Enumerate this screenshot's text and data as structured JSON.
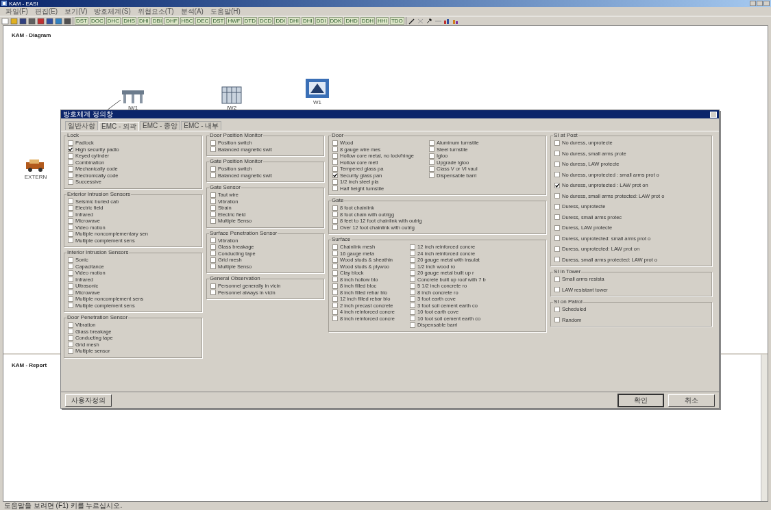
{
  "window": {
    "title": "KAM - EASI"
  },
  "menu": [
    "파일(F)",
    "편집(E)",
    "보기(V)",
    "방호체계(S)",
    "위협요소(T)",
    "분석(A)",
    "도움말(H)"
  ],
  "toolbar": {
    "codes": [
      "DST",
      "DOC",
      "DHC",
      "DHS",
      "DHI",
      "DBI",
      "DHF",
      "HBC",
      "DEC",
      "DST",
      "HWF",
      "DTD",
      "DCD",
      "DDI",
      "DHI",
      "DHI",
      "DDI",
      "DDK",
      "DHD",
      "DDH",
      "HHI",
      "TDO"
    ]
  },
  "diagram": {
    "title": "KAM - Diagram",
    "nodes": [
      {
        "label": "IW1",
        "kind": "fence"
      },
      {
        "label": "IW2",
        "kind": "gate"
      },
      {
        "label": "W1",
        "kind": "building"
      },
      {
        "label": "EXTERN",
        "kind": "vehicle"
      }
    ]
  },
  "report": {
    "title": "KAM - Report"
  },
  "dialog": {
    "title": "방호체계 정의창",
    "tabs": [
      {
        "label": "일반사항",
        "selected": false
      },
      {
        "label": "EMC - 외곽",
        "selected": true
      },
      {
        "label": "EMC - 중앙",
        "selected": false
      },
      {
        "label": "EMC - 내부",
        "selected": false
      }
    ],
    "columns": [
      [
        {
          "title": "Lock",
          "columns": [
            [
              {
                "label": "Padlock",
                "checked": false
              },
              {
                "label": "High security padlo",
                "checked": true
              },
              {
                "label": "Keyed cylinder",
                "checked": false
              },
              {
                "label": "Combination",
                "checked": false
              },
              {
                "label": "Mechanically code",
                "checked": false
              },
              {
                "label": "Electronically code",
                "checked": false
              },
              {
                "label": "Successive",
                "checked": false
              }
            ]
          ]
        },
        {
          "title": "Exterior Intrusion Sensors",
          "columns": [
            [
              {
                "label": "Seismic buried cab",
                "checked": false
              },
              {
                "label": "Electric field",
                "checked": false
              },
              {
                "label": "Infrared",
                "checked": false
              },
              {
                "label": "Microwave",
                "checked": false
              },
              {
                "label": "Video motion",
                "checked": false
              },
              {
                "label": "Multiple noncomplementary sen",
                "checked": false
              },
              {
                "label": "Multiple complement sens",
                "checked": false
              }
            ]
          ]
        },
        {
          "title": "Interior Intrusion Sensors",
          "columns": [
            [
              {
                "label": "Sonic",
                "checked": false
              },
              {
                "label": "Capacitance",
                "checked": false
              },
              {
                "label": "Video motion",
                "checked": false
              },
              {
                "label": "Infrared",
                "checked": false
              },
              {
                "label": "Ultrasonic",
                "checked": false
              },
              {
                "label": "Microwave",
                "checked": false
              },
              {
                "label": "Multiple noncomplement sens",
                "checked": false
              },
              {
                "label": "Multiple complement sens",
                "checked": false
              }
            ]
          ]
        },
        {
          "title": "Door Penetration Sensor",
          "columns": [
            [
              {
                "label": "Vibration",
                "checked": false
              },
              {
                "label": "Glass breakage",
                "checked": false
              },
              {
                "label": "Conducting tape",
                "checked": false
              },
              {
                "label": "Grid mesh",
                "checked": false
              },
              {
                "label": "Multiple sensor",
                "checked": false
              }
            ]
          ]
        }
      ],
      [
        {
          "title": "Door Position Monitor",
          "columns": [
            [
              {
                "label": "Position switch",
                "checked": false
              },
              {
                "label": "Balanced magnetic swit",
                "checked": false
              }
            ]
          ]
        },
        {
          "title": "Gate Position Monitor",
          "columns": [
            [
              {
                "label": "Position switch",
                "checked": false
              },
              {
                "label": "Balanced magnetic swit",
                "checked": false
              }
            ]
          ]
        },
        {
          "title": "Gate Sensor",
          "columns": [
            [
              {
                "label": "Taut wire",
                "checked": false
              },
              {
                "label": "Vibration",
                "checked": false
              },
              {
                "label": "Strain",
                "checked": false
              },
              {
                "label": "Electric field",
                "checked": false
              },
              {
                "label": "Multiple Senso",
                "checked": false
              }
            ]
          ]
        },
        {
          "title": "Surface Penetration Sensor",
          "columns": [
            [
              {
                "label": "Vibration",
                "checked": false
              },
              {
                "label": "Glass breakage",
                "checked": false
              },
              {
                "label": "Conducting tape",
                "checked": false
              },
              {
                "label": "Grid mesh",
                "checked": false
              },
              {
                "label": "Multiple Senso",
                "checked": false
              }
            ]
          ]
        },
        {
          "title": "General Observation",
          "columns": [
            [
              {
                "label": "Personnel generally in vicin",
                "checked": false
              },
              {
                "label": "Personnel always in vicin",
                "checked": false
              }
            ]
          ]
        }
      ],
      [
        {
          "title": "Door",
          "columns": [
            [
              {
                "label": "Wood",
                "checked": false
              },
              {
                "label": "8 gauge wire mes",
                "checked": false
              },
              {
                "label": "Hollow core metal, no lock/hinge",
                "checked": false
              },
              {
                "label": "Hollow core metl",
                "checked": false
              },
              {
                "label": "Tempered glass pa",
                "checked": false
              },
              {
                "label": "Security glass pan",
                "checked": true
              },
              {
                "label": "1/2 inch steel pla",
                "checked": false
              },
              {
                "label": "Half height turnstile",
                "checked": false
              }
            ],
            [
              {
                "label": "Aluminum turnstile",
                "checked": false
              },
              {
                "label": "Steel turnstile",
                "checked": false
              },
              {
                "label": "Igloo",
                "checked": false
              },
              {
                "label": "Upgrade Igloo",
                "checked": false
              },
              {
                "label": "Class V or VI vaul",
                "checked": false
              },
              {
                "label": "Dispensable barri",
                "checked": false
              }
            ]
          ]
        },
        {
          "title": "Gate",
          "columns": [
            [
              {
                "label": "8 foot chainlink",
                "checked": false
              },
              {
                "label": "8 foot chain with outrigg",
                "checked": false
              },
              {
                "label": "8 feet to 12 foot chainlink with outrig",
                "checked": false
              },
              {
                "label": "Over 12 foot chainlink with outrig",
                "checked": false
              }
            ]
          ]
        },
        {
          "title": "Surface",
          "columns": [
            [
              {
                "label": "Chainlink mesh",
                "checked": false
              },
              {
                "label": "16 gauge meta",
                "checked": false
              },
              {
                "label": "Wood studs & sheathin",
                "checked": false
              },
              {
                "label": "Wood studs & plywoo",
                "checked": false
              },
              {
                "label": "Clay block",
                "checked": false
              },
              {
                "label": "8 inch hollow blo",
                "checked": false
              },
              {
                "label": "8 inch filled bloc",
                "checked": false
              },
              {
                "label": "8 inch filled rebar blo",
                "checked": false
              },
              {
                "label": "12 inch filled rebar blo",
                "checked": false
              },
              {
                "label": "2 inch precast concrete",
                "checked": false
              },
              {
                "label": "4 inch reinforced concre",
                "checked": false
              },
              {
                "label": "8 inch reinforced concre",
                "checked": false
              }
            ],
            [
              {
                "label": "12 inch reinforced concre",
                "checked": false
              },
              {
                "label": "24 inch reinforced concre",
                "checked": false
              },
              {
                "label": "20 gauge metal with insulat",
                "checked": false
              },
              {
                "label": "1/2 inch wood ro",
                "checked": false
              },
              {
                "label": "20 gauge metal built up r",
                "checked": false
              },
              {
                "label": "Concrete built up roof with 7 b",
                "checked": false
              },
              {
                "label": "5 1/2 inch concrete ro",
                "checked": false
              },
              {
                "label": "8 inch concrete ro",
                "checked": false
              },
              {
                "label": "3 foot earth cove",
                "checked": false
              },
              {
                "label": "3 foot soil cement earth co",
                "checked": false
              },
              {
                "label": "10 foot earth cove",
                "checked": false
              },
              {
                "label": "10 foot soil cement earth co",
                "checked": false
              },
              {
                "label": "Dispensable barri",
                "checked": false
              }
            ]
          ]
        }
      ],
      [
        {
          "title": "SI at Post",
          "columns": [
            [
              {
                "label": "No duress, unprotecte",
                "checked": false
              },
              {
                "label": "No duress, small arms prote",
                "checked": false
              },
              {
                "label": "No duress, LAW protecte",
                "checked": false
              },
              {
                "label": "No duress, unprotected : small arms prot o",
                "checked": false
              },
              {
                "label": "No duress, unprotected : LAW prot on",
                "checked": true
              },
              {
                "label": "No duress, small arms protected: LAW prot o",
                "checked": false
              },
              {
                "label": "Duress, unprotecte",
                "checked": false
              },
              {
                "label": "Duress, small arms protec",
                "checked": false
              },
              {
                "label": "Duress, LAW protecte",
                "checked": false
              },
              {
                "label": "Duress, unprotected: small arms prot o",
                "checked": false
              },
              {
                "label": "Duress, unprotected: LAW prot on",
                "checked": false
              },
              {
                "label": "Duress, small arms protected: LAW prot o",
                "checked": false
              }
            ]
          ]
        },
        {
          "title": "SI in Tower",
          "columns": [
            [
              {
                "label": "Small arms resista",
                "checked": false
              },
              {
                "label": "LAW resistant tower",
                "checked": false
              }
            ]
          ]
        },
        {
          "title": "SI on Patrol",
          "columns": [
            [
              {
                "label": "Scheduled",
                "checked": false
              },
              {
                "label": "Random",
                "checked": false
              }
            ]
          ]
        }
      ]
    ],
    "buttons": {
      "left": "사용자정의",
      "ok": "확인",
      "cancel": "취소"
    }
  },
  "status_bar": "도움말을 보려면 (F1) 키를 누르십시오."
}
